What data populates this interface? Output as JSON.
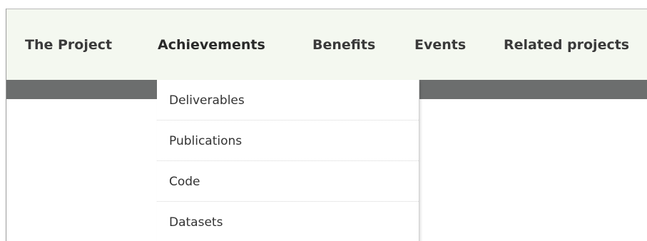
{
  "nav": {
    "items": [
      {
        "label": "The Project"
      },
      {
        "label": "Achievements"
      },
      {
        "label": "Benefits"
      },
      {
        "label": "Events"
      },
      {
        "label": "Related projects"
      }
    ],
    "active_item": "Achievements"
  },
  "dropdown": {
    "items": [
      {
        "label": "Deliverables"
      },
      {
        "label": "Publications"
      },
      {
        "label": "Code"
      },
      {
        "label": "Datasets"
      }
    ]
  },
  "colors": {
    "nav_background": "#f4f8f0",
    "subbar_background": "#6c6e6e",
    "nav_text": "#3a3a3a"
  }
}
